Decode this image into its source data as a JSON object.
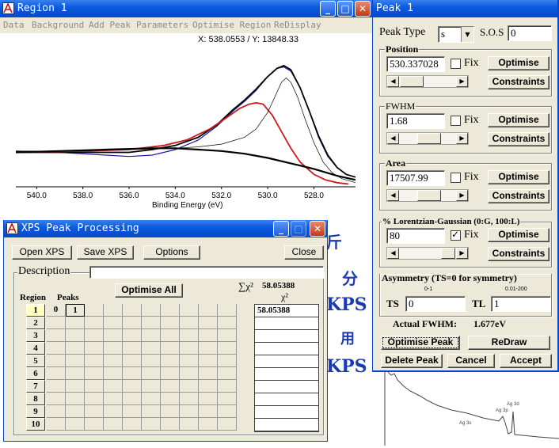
{
  "region_window": {
    "title": "Region 1",
    "menu": [
      "Data",
      "Background",
      "Add Peak",
      "Parameters",
      "Optimise Region",
      "ReDisplay"
    ],
    "coord_readout": "X: 538.0553 / Y: 13848.33"
  },
  "chart_data": {
    "type": "line",
    "xlabel": "Binding Energy (eV)",
    "x_ticks": [
      "540.0",
      "538.0",
      "536.0",
      "534.0",
      "532.0",
      "530.0",
      "528.0"
    ],
    "xlim": [
      540.9,
      526.2
    ],
    "series": [
      {
        "color": "#1a1aa0",
        "x": [
          540.9,
          539.0,
          537.0,
          536.0,
          535.0,
          534.0,
          533.0,
          532.2,
          531.5,
          531.0,
          530.5,
          530.0,
          529.6,
          529.3,
          529.0,
          528.6,
          528.2,
          527.8,
          527.4,
          527.0,
          526.6,
          526.2
        ],
        "y": [
          0.26,
          0.25,
          0.23,
          0.22,
          0.23,
          0.27,
          0.34,
          0.44,
          0.55,
          0.62,
          0.7,
          0.8,
          0.86,
          0.87,
          0.84,
          0.72,
          0.55,
          0.36,
          0.22,
          0.14,
          0.09,
          0.07
        ]
      },
      {
        "color": "#000000",
        "x": [
          540.9,
          539.0,
          537.0,
          536.0,
          535.0,
          534.0,
          533.0,
          532.2,
          531.5,
          531.0,
          530.5,
          530.0,
          529.6,
          529.3,
          529.0,
          528.6,
          528.2,
          527.8,
          527.4,
          527.0,
          526.6,
          526.2
        ],
        "y": [
          0.25,
          0.25,
          0.25,
          0.25,
          0.27,
          0.3,
          0.36,
          0.45,
          0.56,
          0.63,
          0.71,
          0.8,
          0.86,
          0.88,
          0.85,
          0.72,
          0.55,
          0.37,
          0.23,
          0.14,
          0.09,
          0.07
        ]
      },
      {
        "color": "#cc1a1a",
        "x": [
          540.9,
          538.0,
          536.0,
          534.5,
          533.5,
          532.5,
          531.8,
          531.2,
          530.8,
          530.5,
          530.2,
          529.8,
          529.4,
          529.0,
          528.6,
          528.0,
          527.5,
          527.0,
          526.5
        ],
        "y": [
          0.25,
          0.26,
          0.27,
          0.3,
          0.34,
          0.42,
          0.5,
          0.57,
          0.6,
          0.61,
          0.6,
          0.52,
          0.4,
          0.28,
          0.18,
          0.09,
          0.05,
          0.03,
          0.02
        ]
      },
      {
        "color": "#000000",
        "x": [
          540.9,
          538.0,
          536.0,
          534.0,
          533.0,
          532.0,
          531.0,
          530.5,
          530.0,
          529.7,
          529.4,
          529.2,
          529.0,
          528.7,
          528.4,
          528.0,
          527.6,
          527.2,
          526.8,
          526.2
        ],
        "y": [
          0.26,
          0.26,
          0.27,
          0.28,
          0.29,
          0.31,
          0.36,
          0.42,
          0.54,
          0.65,
          0.76,
          0.79,
          0.76,
          0.65,
          0.5,
          0.32,
          0.18,
          0.1,
          0.06,
          0.03
        ]
      },
      {
        "color": "#000000",
        "x": [
          540.9,
          539.0,
          537.0,
          535.0,
          534.0,
          533.0,
          532.0,
          531.0,
          530.0,
          529.0,
          528.0,
          527.0,
          526.2
        ],
        "y": [
          0.25,
          0.26,
          0.27,
          0.28,
          0.28,
          0.27,
          0.26,
          0.24,
          0.21,
          0.17,
          0.13,
          0.08,
          0.05
        ]
      }
    ]
  },
  "xps_window": {
    "title": "XPS Peak Processing",
    "open_label": "Open XPS",
    "save_label": "Save XPS",
    "options_label": "Options",
    "close_label": "Close",
    "description_label": "Description",
    "optimise_all_label": "Optimise All",
    "sum_chi_label": "∑χ²",
    "sum_chi_value": "58.05388",
    "chi_label": "χ²",
    "chi_values": [
      "58.05388",
      "",
      "",
      "",
      "",
      "",
      "",
      "",
      "",
      ""
    ],
    "region_header": "Region",
    "peaks_header": "Peaks",
    "regions": [
      "1",
      "2",
      "3",
      "4",
      "5",
      "6",
      "7",
      "8",
      "9",
      "10"
    ],
    "peak_row1": [
      "0",
      "1"
    ]
  },
  "peak_window": {
    "title": "Peak 1",
    "peak_type_label": "Peak Type",
    "peak_type_value": "s",
    "sos_label": "S.O.S",
    "sos_value": "0",
    "position_label": "Position",
    "position_value": "530.337028",
    "fwhm_label": "FWHM",
    "fwhm_value": "1.68",
    "area_label": "Area",
    "area_value": "17507.99",
    "lg_label": "% Lorentzian-Gaussian (0:G, 100:L)",
    "lg_value": "80",
    "fix_label": "Fix",
    "optimise_label": "Optimise",
    "constraints_label": "Constraints",
    "asym_label": "Asymmetry (TS=0 for symmetry)",
    "ts_range": "0-1",
    "tl_range": "0.01-200",
    "ts_label": "TS",
    "ts_value": "0",
    "tl_label": "TL",
    "tl_value": "1",
    "actual_fwhm_label": "Actual FWHM:",
    "actual_fwhm_value": "1.677eV",
    "optimise_peak_label": "Optimise Peak",
    "redraw_label": "ReDraw",
    "delete_label": "Delete Peak",
    "cancel_label": "Cancel",
    "accept_label": "Accept"
  },
  "background": {
    "doc_chars": [
      "斤",
      "分",
      "KPS",
      "用",
      "KPS"
    ],
    "small_peak_labels": [
      "Ag 3d",
      "Ag 3p",
      "Ag 3s"
    ]
  }
}
